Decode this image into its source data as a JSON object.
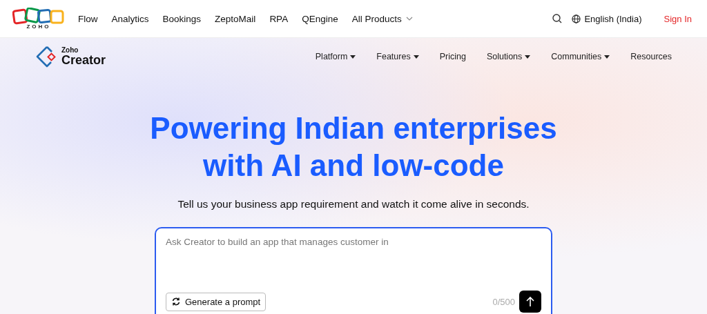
{
  "top_bar": {
    "logo_text": "ZOHO",
    "products": [
      {
        "label": "Flow",
        "dropdown": false
      },
      {
        "label": "Analytics",
        "dropdown": false
      },
      {
        "label": "Bookings",
        "dropdown": false
      },
      {
        "label": "ZeptoMail",
        "dropdown": false
      },
      {
        "label": "RPA",
        "dropdown": false
      },
      {
        "label": "QEngine",
        "dropdown": false
      },
      {
        "label": "All Products",
        "dropdown": true
      }
    ],
    "language": "English (India)",
    "sign_in": "Sign In"
  },
  "product_nav": {
    "brand_small": "Zoho",
    "brand": "Creator",
    "items": [
      {
        "label": "Platform",
        "dropdown": true
      },
      {
        "label": "Features",
        "dropdown": true
      },
      {
        "label": "Pricing",
        "dropdown": false
      },
      {
        "label": "Solutions",
        "dropdown": true
      },
      {
        "label": "Communities",
        "dropdown": true
      },
      {
        "label": "Resources",
        "dropdown": false
      }
    ]
  },
  "hero": {
    "title_lines": [
      "Powering Indian enterprises",
      "with AI and low-code"
    ],
    "subtitle": "Tell us your business app requirement and watch it come alive in seconds.",
    "prompt": {
      "placeholder": "Ask Creator to build an app that manages customer in",
      "generate_button": "Generate a prompt",
      "counter": "0/500"
    }
  }
}
